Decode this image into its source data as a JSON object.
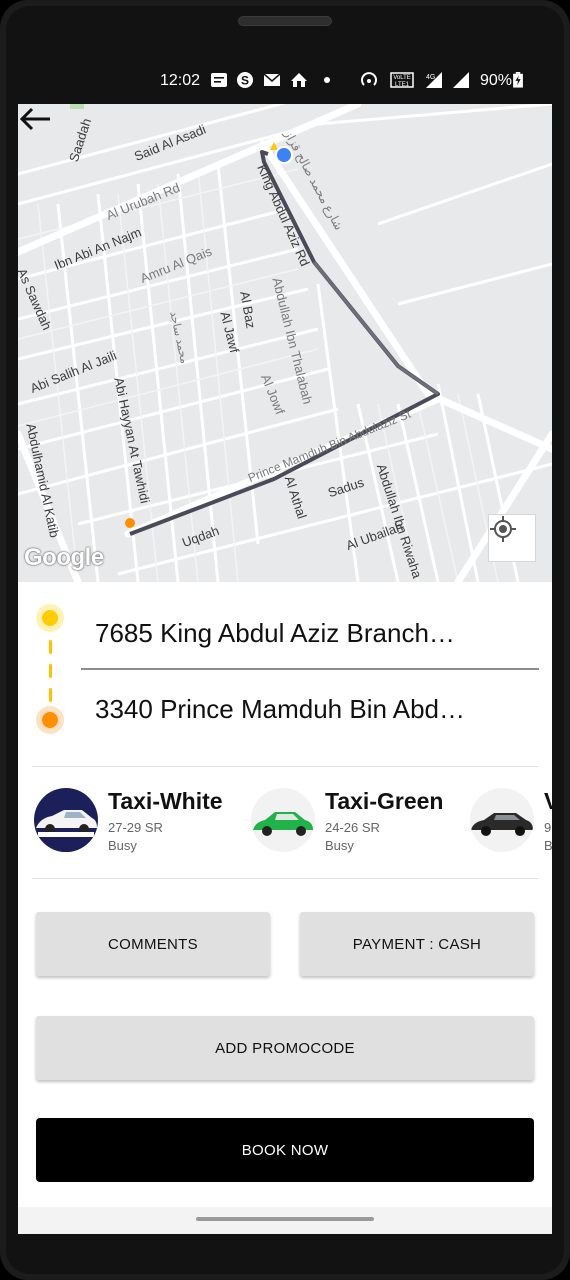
{
  "status_bar": {
    "time": "12:02",
    "icons": [
      "message-icon",
      "skype-icon",
      "mail-icon",
      "home-icon",
      "dot-icon",
      "hotspot-icon",
      "volte-icon",
      "4g-signal-icon",
      "signal-icon",
      "battery-icon"
    ],
    "battery": "90%"
  },
  "map": {
    "back_icon": "arrow-left-icon",
    "google_logo": "Google",
    "locate_icon": "my-location-icon",
    "streets": [
      "Saadah",
      "Said Al Asadi",
      "Al Urubah Rd",
      "Ibn Abi An Najm",
      "Amru Al Qais",
      "King Abdul Aziz Rd",
      "As Sawdah",
      "Al Baz",
      "Al Jawf",
      "Abdullah Ibn Thalabah",
      "Abi Salih Al Jaili",
      "Abi Hayyan At Tawhidi",
      "Al Jowf",
      "Abdulhamid Al Katib",
      "Prince Mamduh Bin Abdulaziz St",
      "Al Athal",
      "Sadus",
      "Abdullah Ibn Riwaha",
      "Al Ubailah",
      "Uqdah",
      "شارع محمد صالح قزاز",
      "محمد ساجد"
    ]
  },
  "trip": {
    "pickup": "7685 King Abdul Aziz Branch…",
    "dropoff": "3340 Prince Mamduh Bin Abd…"
  },
  "cars": [
    {
      "name": "Taxi-White",
      "price": "27-29 SR",
      "status": "Busy"
    },
    {
      "name": "Taxi-Green",
      "price": "24-26 SR",
      "status": "Busy"
    },
    {
      "name": "V",
      "price": "9",
      "status": "B"
    }
  ],
  "buttons": {
    "comments": "COMMENTS",
    "payment": "PAYMENT : CASH",
    "promo": "ADD PROMOCODE",
    "book": "BOOK NOW"
  },
  "colors": {
    "pickup": "#ffcb05",
    "dropoff": "#ff8f00",
    "route": "#4a4a5a",
    "book_button": "#000000"
  }
}
